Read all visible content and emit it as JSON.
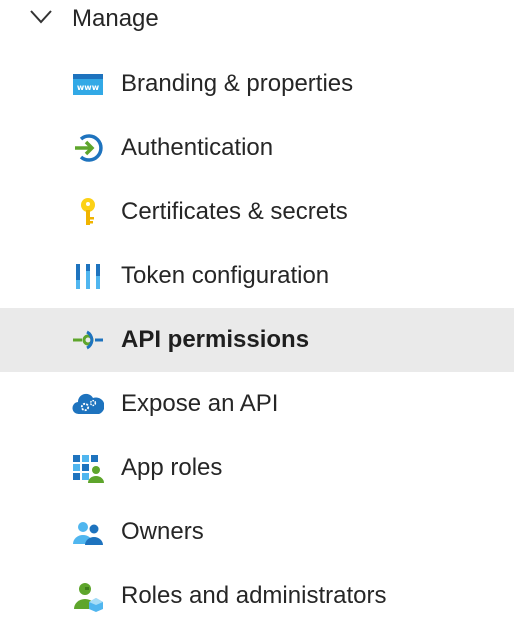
{
  "section": {
    "label": "Manage",
    "expanded": true,
    "chevron_icon": "chevron-down-icon"
  },
  "colors": {
    "selected_background": "#eaeaea",
    "text": "#262626",
    "accent_blue": "#0078d4",
    "accent_green": "#5ea52c",
    "key_yellow": "#fcd116"
  },
  "items": [
    {
      "label": "Branding & properties",
      "icon": "branding-www-icon",
      "selected": false
    },
    {
      "label": "Authentication",
      "icon": "authentication-arrow-icon",
      "selected": false
    },
    {
      "label": "Certificates & secrets",
      "icon": "key-icon",
      "selected": false
    },
    {
      "label": "Token configuration",
      "icon": "token-bars-icon",
      "selected": false
    },
    {
      "label": "API permissions",
      "icon": "api-permissions-icon",
      "selected": true
    },
    {
      "label": "Expose an API",
      "icon": "cloud-gear-icon",
      "selected": false
    },
    {
      "label": "App roles",
      "icon": "app-roles-grid-icon",
      "selected": false
    },
    {
      "label": "Owners",
      "icon": "owners-people-icon",
      "selected": false
    },
    {
      "label": "Roles and administrators",
      "icon": "roles-admin-icon",
      "selected": false
    }
  ]
}
